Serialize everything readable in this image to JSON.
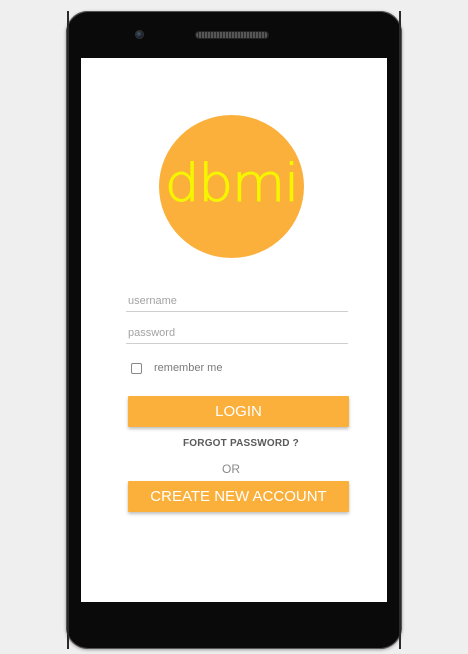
{
  "colors": {
    "accent": "#fbb03b",
    "logo_text": "#f5f500",
    "frame": "#0a0a0a",
    "screen": "#ffffff"
  },
  "logo": {
    "text": "dbmi"
  },
  "login_form": {
    "username_placeholder": "username",
    "username_value": "",
    "password_placeholder": "password",
    "password_value": "",
    "remember_label": "remember me",
    "remember_checked": false,
    "login_label": "LOGIN",
    "forgot_label": "FORGOT PASSWORD ?",
    "or_label": "OR",
    "create_label": "CREATE NEW ACCOUNT"
  },
  "device": {
    "camera_icon": "front-camera",
    "speaker_icon": "earpiece-speaker"
  }
}
